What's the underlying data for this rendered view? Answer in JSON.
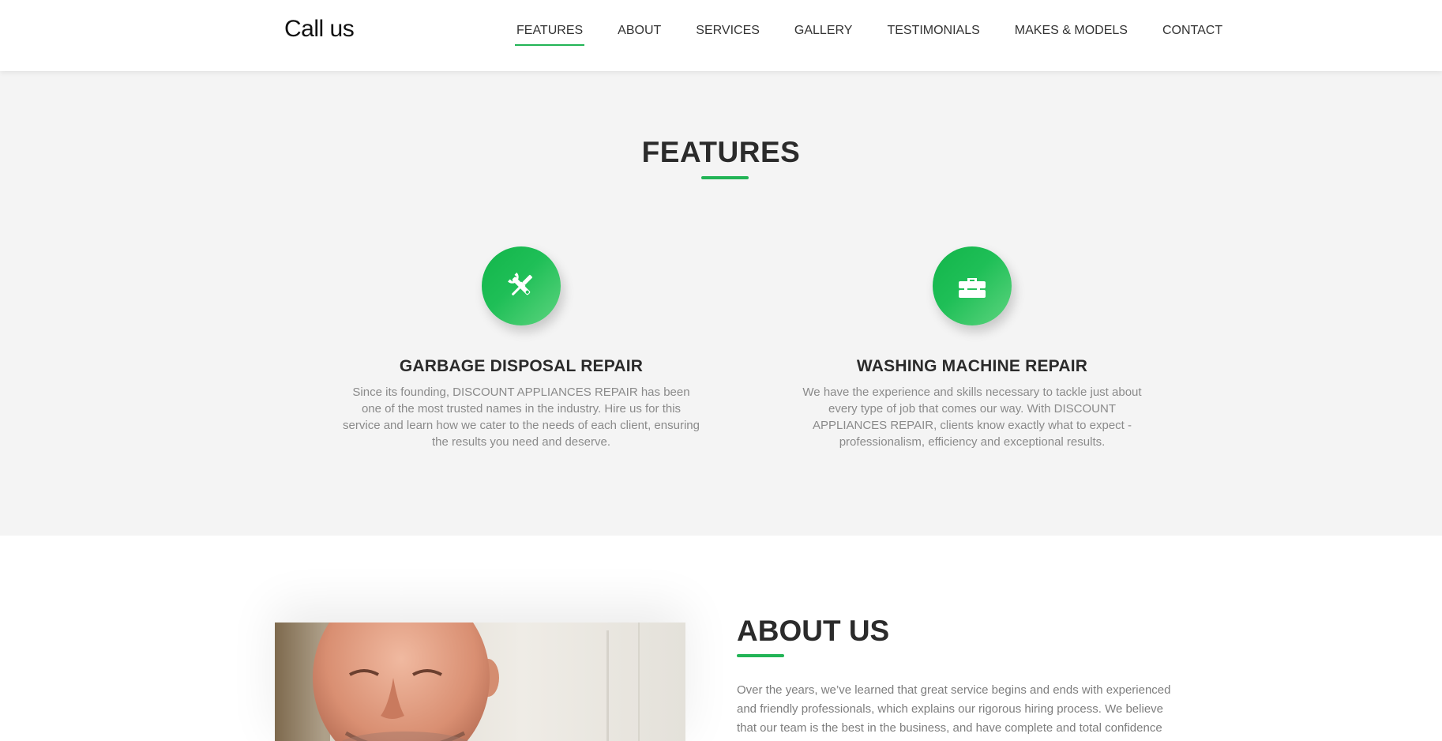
{
  "header": {
    "brand": "Call us",
    "nav": [
      {
        "label": "FEATURES",
        "active": true
      },
      {
        "label": "ABOUT"
      },
      {
        "label": "SERVICES"
      },
      {
        "label": "GALLERY"
      },
      {
        "label": "TESTIMONIALS"
      },
      {
        "label": "MAKES & MODELS"
      },
      {
        "label": "CONTACT"
      }
    ]
  },
  "features": {
    "title": "FEATURES",
    "items": [
      {
        "icon": "tools-icon",
        "title": "GARBAGE DISPOSAL REPAIR",
        "text": "Since its founding, DISCOUNT APPLIANCES REPAIR has been one of the most trusted names in the industry. Hire us for this service and learn how we cater to the needs of each client, ensuring the results you need and deserve."
      },
      {
        "icon": "toolbox-icon",
        "title": "WASHING MACHINE REPAIR",
        "text": "We have the experience and skills necessary to tackle just about every type of job that comes our way. With DISCOUNT APPLIANCES REPAIR, clients know exactly what to expect - professionalism, efficiency and exceptional results."
      }
    ]
  },
  "about": {
    "title": "ABOUT US",
    "text": "Over the years, we’ve learned that great service begins and ends with experienced and friendly professionals, which explains our rigorous hiring process. We believe that our team is the best in the business, and have complete and total confidence in"
  },
  "colors": {
    "accent": "#22b456",
    "section_bg": "#f4f4f4",
    "heading": "#2b2b2b",
    "body_text": "#8a8a8a"
  }
}
